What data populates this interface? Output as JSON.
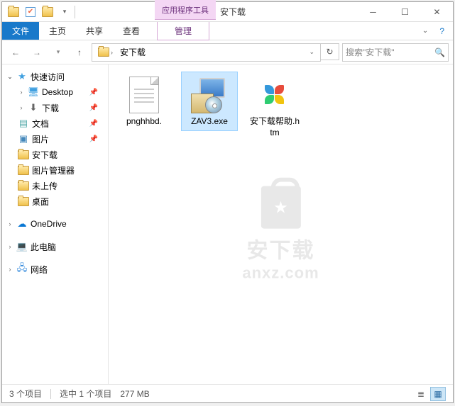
{
  "titlebar": {
    "context_tab": "应用程序工具",
    "title": "安下载"
  },
  "ribbon": {
    "file": "文件",
    "home": "主页",
    "share": "共享",
    "view": "查看",
    "manage": "管理"
  },
  "breadcrumb": {
    "current": "安下载"
  },
  "search": {
    "placeholder": "搜索\"安下载\""
  },
  "sidebar": {
    "quick_access": "快速访问",
    "items": [
      {
        "label": "Desktop",
        "pinned": true,
        "icon": "desktop"
      },
      {
        "label": "下载",
        "pinned": true,
        "icon": "download"
      },
      {
        "label": "文档",
        "pinned": true,
        "icon": "document"
      },
      {
        "label": "图片",
        "pinned": true,
        "icon": "picture"
      },
      {
        "label": "安下载",
        "pinned": false,
        "icon": "folder"
      },
      {
        "label": "图片管理器",
        "pinned": false,
        "icon": "folder"
      },
      {
        "label": "未上传",
        "pinned": false,
        "icon": "folder"
      },
      {
        "label": "桌面",
        "pinned": false,
        "icon": "folder"
      }
    ],
    "onedrive": "OneDrive",
    "this_pc": "此电脑",
    "network": "网络"
  },
  "files": [
    {
      "name": "pnghhbd.",
      "type": "doc",
      "selected": false
    },
    {
      "name": "ZAV3.exe",
      "type": "exe",
      "selected": true
    },
    {
      "name": "安下载帮助.htm",
      "type": "htm",
      "selected": false
    }
  ],
  "statusbar": {
    "count": "3 个项目",
    "selection": "选中 1 个项目",
    "size": "277 MB"
  },
  "watermark": {
    "line1": "安下载",
    "line2": "anxz.com"
  }
}
